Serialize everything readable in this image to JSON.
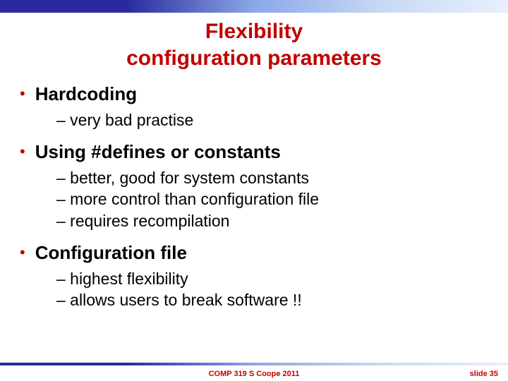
{
  "title_line1": "Flexibility",
  "title_line2": "configuration parameters",
  "bullets": [
    {
      "heading": "Hardcoding",
      "subs": [
        "– very bad practise"
      ]
    },
    {
      "heading": "Using #defines or constants",
      "subs": [
        "– better, good for system constants",
        "– more control than configuration file",
        "– requires recompilation"
      ]
    },
    {
      "heading": "Configuration file",
      "subs": [
        "– highest flexibility",
        "– allows users to break software !!"
      ]
    }
  ],
  "footer": {
    "center": "COMP 319 S Coope 2011",
    "right": "slide 35"
  }
}
